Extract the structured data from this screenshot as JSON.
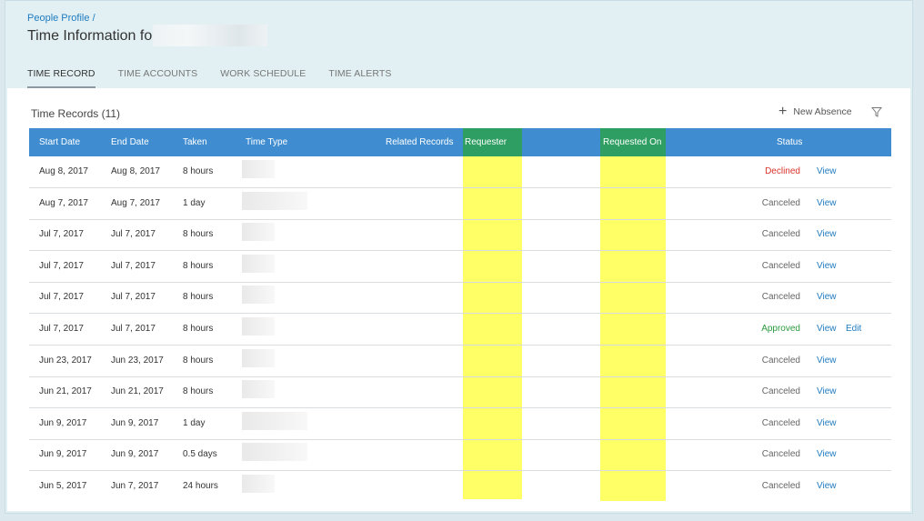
{
  "breadcrumb": {
    "parent": "People Profile",
    "separator": "/"
  },
  "title": "Time Information for",
  "tabs": [
    {
      "label": "TIME RECORD",
      "active": true
    },
    {
      "label": "TIME ACCOUNTS",
      "active": false
    },
    {
      "label": "WORK SCHEDULE",
      "active": false
    },
    {
      "label": "TIME ALERTS",
      "active": false
    }
  ],
  "panel": {
    "title": "Time Records (11)",
    "new_absence": "New Absence"
  },
  "table": {
    "headers": {
      "start_date": "Start Date",
      "end_date": "End Date",
      "taken": "Taken",
      "time_type": "Time Type",
      "related_records": "Related Records",
      "requester": "Requester",
      "requested_on": "Requested On",
      "status": "Status"
    },
    "rows": [
      {
        "start": "Aug 8, 2017",
        "end": "Aug 8, 2017",
        "taken": "8 hours",
        "status": "Declined",
        "status_kind": "declined",
        "view": "View"
      },
      {
        "start": "Aug 7, 2017",
        "end": "Aug 7, 2017",
        "taken": "1 day",
        "status": "Canceled",
        "status_kind": "canceled",
        "view": "View"
      },
      {
        "start": "Jul 7, 2017",
        "end": "Jul 7, 2017",
        "taken": "8 hours",
        "status": "Canceled",
        "status_kind": "canceled",
        "view": "View"
      },
      {
        "start": "Jul 7, 2017",
        "end": "Jul 7, 2017",
        "taken": "8 hours",
        "status": "Canceled",
        "status_kind": "canceled",
        "view": "View"
      },
      {
        "start": "Jul 7, 2017",
        "end": "Jul 7, 2017",
        "taken": "8 hours",
        "status": "Canceled",
        "status_kind": "canceled",
        "view": "View"
      },
      {
        "start": "Jul 7, 2017",
        "end": "Jul 7, 2017",
        "taken": "8 hours",
        "status": "Approved",
        "status_kind": "approved",
        "view": "View",
        "edit": "Edit"
      },
      {
        "start": "Jun 23, 2017",
        "end": "Jun 23, 2017",
        "taken": "8 hours",
        "status": "Canceled",
        "status_kind": "canceled",
        "view": "View"
      },
      {
        "start": "Jun 21, 2017",
        "end": "Jun 21, 2017",
        "taken": "8 hours",
        "status": "Canceled",
        "status_kind": "canceled",
        "view": "View"
      },
      {
        "start": "Jun 9, 2017",
        "end": "Jun 9, 2017",
        "taken": "1 day",
        "status": "Canceled",
        "status_kind": "canceled",
        "view": "View"
      },
      {
        "start": "Jun 9, 2017",
        "end": "Jun 9, 2017",
        "taken": "0.5 days",
        "status": "Canceled",
        "status_kind": "canceled",
        "view": "View"
      },
      {
        "start": "Jun 5, 2017",
        "end": "Jun 7, 2017",
        "taken": "24 hours",
        "status": "Canceled",
        "status_kind": "canceled",
        "view": "View"
      }
    ]
  },
  "colors": {
    "header_bar": "#3f8dd0",
    "highlight_yellow": "#ffff66",
    "highlight_header_green": "#2e9e62",
    "link_blue": "#1f7bbf",
    "declined_red": "#d9342b",
    "approved_green": "#2a9a3e",
    "canceled_gray": "#666666"
  },
  "icons": {
    "add": "plus-icon",
    "filter": "filter-icon"
  }
}
